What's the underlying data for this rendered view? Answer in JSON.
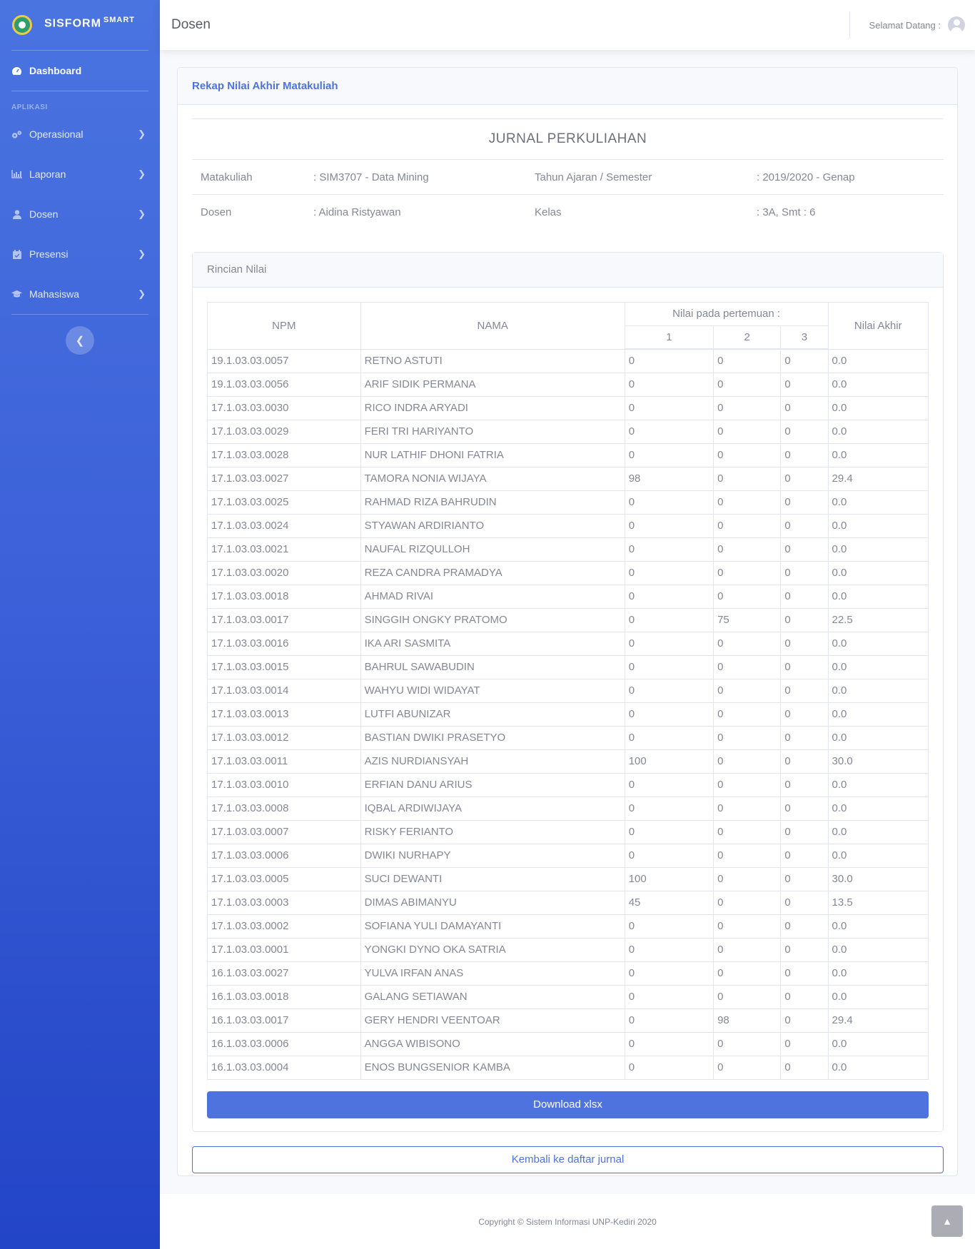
{
  "brand": {
    "name": "SISFORM",
    "sup": "SMART"
  },
  "sidebar": {
    "dashboard": "Dashboard",
    "heading": "APLIKASI",
    "items": [
      {
        "label": "Operasional",
        "icon": "cogs-icon"
      },
      {
        "label": "Laporan",
        "icon": "chart-icon"
      },
      {
        "label": "Dosen",
        "icon": "user-icon"
      },
      {
        "label": "Presensi",
        "icon": "calendar-icon"
      },
      {
        "label": "Mahasiswa",
        "icon": "graduation-cap-icon"
      }
    ]
  },
  "topbar": {
    "title": "Dosen",
    "welcome": "Selamat Datang :"
  },
  "card": {
    "title": "Rekap Nilai Akhir Matakuliah",
    "journal_title": "JURNAL PERKULIAHAN",
    "info": {
      "matakuliah_label": "Matakuliah",
      "matakuliah_value": ": SIM3707 - Data Mining",
      "tahun_label": "Tahun Ajaran / Semester",
      "tahun_value": ": 2019/2020 - Genap",
      "dosen_label": "Dosen",
      "dosen_value": ": Aidina Ristyawan",
      "kelas_label": "Kelas",
      "kelas_value": ": 3A, Smt : 6"
    },
    "rincian_title": "Rincian Nilai",
    "table": {
      "npm": "NPM",
      "nama": "NAMA",
      "group": "Nilai pada pertemuan :",
      "akhir": "Nilai Akhir",
      "p1": "1",
      "p2": "2",
      "p3": "3",
      "rows": [
        [
          "19.1.03.03.0057",
          "RETNO ASTUTI",
          "0",
          "0",
          "0",
          "0.0"
        ],
        [
          "19.1.03.03.0056",
          "ARIF SIDIK PERMANA",
          "0",
          "0",
          "0",
          "0.0"
        ],
        [
          "17.1.03.03.0030",
          "RICO INDRA ARYADI",
          "0",
          "0",
          "0",
          "0.0"
        ],
        [
          "17.1.03.03.0029",
          "FERI TRI HARIYANTO",
          "0",
          "0",
          "0",
          "0.0"
        ],
        [
          "17.1.03.03.0028",
          "NUR LATHIF DHONI FATRIA",
          "0",
          "0",
          "0",
          "0.0"
        ],
        [
          "17.1.03.03.0027",
          "TAMORA NONIA WIJAYA",
          "98",
          "0",
          "0",
          "29.4"
        ],
        [
          "17.1.03.03.0025",
          "RAHMAD RIZA BAHRUDIN",
          "0",
          "0",
          "0",
          "0.0"
        ],
        [
          "17.1.03.03.0024",
          "STYAWAN ARDIRIANTO",
          "0",
          "0",
          "0",
          "0.0"
        ],
        [
          "17.1.03.03.0021",
          "NAUFAL RIZQULLOH",
          "0",
          "0",
          "0",
          "0.0"
        ],
        [
          "17.1.03.03.0020",
          "REZA CANDRA PRAMADYA",
          "0",
          "0",
          "0",
          "0.0"
        ],
        [
          "17.1.03.03.0018",
          "AHMAD RIVAI",
          "0",
          "0",
          "0",
          "0.0"
        ],
        [
          "17.1.03.03.0017",
          "SINGGIH ONGKY PRATOMO",
          "0",
          "75",
          "0",
          "22.5"
        ],
        [
          "17.1.03.03.0016",
          "IKA ARI SASMITA",
          "0",
          "0",
          "0",
          "0.0"
        ],
        [
          "17.1.03.03.0015",
          "BAHRUL SAWABUDIN",
          "0",
          "0",
          "0",
          "0.0"
        ],
        [
          "17.1.03.03.0014",
          "WAHYU WIDI WIDAYAT",
          "0",
          "0",
          "0",
          "0.0"
        ],
        [
          "17.1.03.03.0013",
          "LUTFI ABUNIZAR",
          "0",
          "0",
          "0",
          "0.0"
        ],
        [
          "17.1.03.03.0012",
          "BASTIAN DWIKI PRASETYO",
          "0",
          "0",
          "0",
          "0.0"
        ],
        [
          "17.1.03.03.0011",
          "AZIS NURDIANSYAH",
          "100",
          "0",
          "0",
          "30.0"
        ],
        [
          "17.1.03.03.0010",
          "ERFIAN DANU ARIUS",
          "0",
          "0",
          "0",
          "0.0"
        ],
        [
          "17.1.03.03.0008",
          "IQBAL ARDIWIJAYA",
          "0",
          "0",
          "0",
          "0.0"
        ],
        [
          "17.1.03.03.0007",
          "RISKY FERIANTO",
          "0",
          "0",
          "0",
          "0.0"
        ],
        [
          "17.1.03.03.0006",
          "DWIKI NURHAPY",
          "0",
          "0",
          "0",
          "0.0"
        ],
        [
          "17.1.03.03.0005",
          "SUCI DEWANTI",
          "100",
          "0",
          "0",
          "30.0"
        ],
        [
          "17.1.03.03.0003",
          "DIMAS ABIMANYU",
          "45",
          "0",
          "0",
          "13.5"
        ],
        [
          "17.1.03.03.0002",
          "SOFIANA YULI DAMAYANTI",
          "0",
          "0",
          "0",
          "0.0"
        ],
        [
          "17.1.03.03.0001",
          "YONGKI DYNO OKA SATRIA",
          "0",
          "0",
          "0",
          "0.0"
        ],
        [
          "16.1.03.03.0027",
          "YULVA IRFAN ANAS",
          "0",
          "0",
          "0",
          "0.0"
        ],
        [
          "16.1.03.03.0018",
          "GALANG SETIAWAN",
          "0",
          "0",
          "0",
          "0.0"
        ],
        [
          "16.1.03.03.0017",
          "GERY HENDRI VEENTOAR",
          "0",
          "98",
          "0",
          "29.4"
        ],
        [
          "16.1.03.03.0006",
          "ANGGA WIBISONO",
          "0",
          "0",
          "0",
          "0.0"
        ],
        [
          "16.1.03.03.0004",
          "ENOS BUNGSENIOR KAMBA",
          "0",
          "0",
          "0",
          "0.0"
        ]
      ]
    },
    "download_label": "Download xlsx",
    "back_label": "Kembali ke daftar jurnal"
  },
  "footer": {
    "copyright": "Copyright © Sistem Informasi UNP-Kediri 2020"
  },
  "colors": {
    "primary": "#4e73df",
    "sidebar_top": "#4a74e0",
    "sidebar_bottom": "#2244c6"
  }
}
